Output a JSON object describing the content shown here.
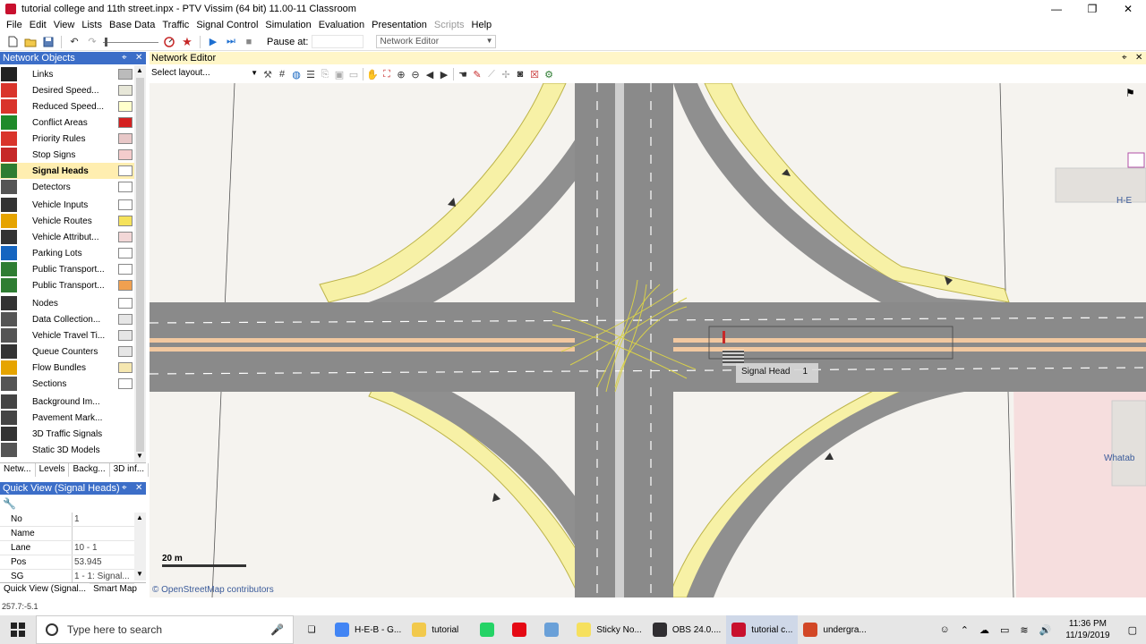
{
  "window": {
    "title": "tutorial college and 11th street.inpx - PTV Vissim (64 bit) 11.00-11 Classroom",
    "controls": [
      "—",
      "❐",
      "✕"
    ]
  },
  "menu": [
    "File",
    "Edit",
    "View",
    "Lists",
    "Base Data",
    "Traffic",
    "Signal Control",
    "Simulation",
    "Evaluation",
    "Presentation",
    "Scripts",
    "Help"
  ],
  "toolbar": {
    "pause_label": "Pause at:",
    "editor_select": "Network Editor"
  },
  "network_objects": {
    "title": "Network Objects",
    "items": [
      {
        "label": "Links",
        "icon": "links-icon",
        "color": "#222222",
        "swatch": "#bbbbbb"
      },
      {
        "label": "Desired Speed...",
        "icon": "desired-speed-icon",
        "color": "#d9342b",
        "swatch": "#e7e7d8"
      },
      {
        "label": "Reduced Speed...",
        "icon": "reduced-speed-icon",
        "color": "#d9342b",
        "swatch": "#ffffcc"
      },
      {
        "label": "Conflict Areas",
        "icon": "conflict-areas-icon",
        "color": "#1f8a2a",
        "swatch": "#d42020"
      },
      {
        "label": "Priority Rules",
        "icon": "priority-rules-icon",
        "color": "#d9342b",
        "swatch": "#e8c8c8"
      },
      {
        "label": "Stop Signs",
        "icon": "stop-signs-icon",
        "color": "#c62828",
        "swatch": "#f4cccc"
      },
      {
        "label": "Signal Heads",
        "icon": "signal-heads-icon",
        "color": "#2e7d32",
        "swatch": "#ffffff"
      },
      {
        "label": "Detectors",
        "icon": "detectors-icon",
        "color": "#555555",
        "swatch": "#ffffff"
      },
      {
        "label": "Vehicle Inputs",
        "icon": "vehicle-inputs-icon",
        "color": "#333333",
        "swatch": "#ffffff"
      },
      {
        "label": "Vehicle Routes",
        "icon": "vehicle-routes-icon",
        "color": "#e6a400",
        "swatch": "#f5e25b"
      },
      {
        "label": "Vehicle Attribut...",
        "icon": "vehicle-attributes-icon",
        "color": "#333333",
        "swatch": "#f2d7d7"
      },
      {
        "label": "Parking Lots",
        "icon": "parking-lots-icon",
        "color": "#1565c0",
        "swatch": "#ffffff"
      },
      {
        "label": "Public Transport...",
        "icon": "public-transport-stops-icon",
        "color": "#2e7d32",
        "swatch": "#ffffff"
      },
      {
        "label": "Public Transport...",
        "icon": "public-transport-lines-icon",
        "color": "#2e7d32",
        "swatch": "#f0a050"
      },
      {
        "label": "Nodes",
        "icon": "nodes-icon",
        "color": "#333333",
        "swatch": "#ffffff"
      },
      {
        "label": "Data Collection...",
        "icon": "data-collection-icon",
        "color": "#555555",
        "swatch": "#e6e6e6"
      },
      {
        "label": "Vehicle Travel Ti...",
        "icon": "vehicle-travel-time-icon",
        "color": "#555555",
        "swatch": "#e6e6e6"
      },
      {
        "label": "Queue Counters",
        "icon": "queue-counters-icon",
        "color": "#333333",
        "swatch": "#e6e6e6"
      },
      {
        "label": "Flow Bundles",
        "icon": "flow-bundles-icon",
        "color": "#e6a400",
        "swatch": "#f5e7b0"
      },
      {
        "label": "Sections",
        "icon": "sections-icon",
        "color": "#555555",
        "swatch": "#ffffff"
      },
      {
        "label": "Background Im...",
        "icon": "background-images-icon",
        "color": "#444444",
        "swatch": ""
      },
      {
        "label": "Pavement Mark...",
        "icon": "pavement-markings-icon",
        "color": "#444444",
        "swatch": ""
      },
      {
        "label": "3D Traffic Signals",
        "icon": "3d-traffic-signals-icon",
        "color": "#333333",
        "swatch": ""
      },
      {
        "label": "Static 3D Models",
        "icon": "static-3d-models-icon",
        "color": "#555555",
        "swatch": ""
      }
    ],
    "selected_index": 6,
    "tabs": [
      "Netw...",
      "Levels",
      "Backg...",
      "3D inf..."
    ]
  },
  "quick_view": {
    "title": "Quick View (Signal Heads)",
    "rows": [
      {
        "key": "No",
        "value": "1"
      },
      {
        "key": "Name",
        "value": ""
      },
      {
        "key": "Lane",
        "value": "10 - 1"
      },
      {
        "key": "Pos",
        "value": "53.945"
      },
      {
        "key": "SG",
        "value": "1 - 1: Signal..."
      }
    ],
    "tabs": [
      "Quick View (Signal...",
      "Smart Map"
    ]
  },
  "network_editor": {
    "title": "Network Editor",
    "layout_select": "Select layout...",
    "scale_label": "20 m",
    "osm_credit": "© OpenStreetMap contributors",
    "signal_head_label": "Signal Head",
    "signal_head_no": "1",
    "poi_label_1": "H-E",
    "poi_label_2": "Whatab"
  },
  "status": {
    "coords": "257.7:-5.1"
  },
  "taskbar": {
    "search_placeholder": "Type here to search",
    "items": [
      {
        "label": "H-E-B - G...",
        "icon": "chrome-icon",
        "color": "#4285f4"
      },
      {
        "label": "tutorial",
        "icon": "folder-icon",
        "color": "#f2c94c"
      },
      {
        "label": "",
        "icon": "whatsapp-icon",
        "color": "#25d366"
      },
      {
        "label": "",
        "icon": "netflix-icon",
        "color": "#e50914"
      },
      {
        "label": "",
        "icon": "notes-app-icon",
        "color": "#6aa0d8"
      },
      {
        "label": "Sticky No...",
        "icon": "sticky-notes-icon",
        "color": "#f6e05e"
      },
      {
        "label": "OBS 24.0....",
        "icon": "obs-icon",
        "color": "#302e31"
      },
      {
        "label": "tutorial c...",
        "icon": "vissim-icon",
        "color": "#c8102e"
      },
      {
        "label": "undergra...",
        "icon": "powerpoint-icon",
        "color": "#d24726"
      }
    ],
    "time": "11:36 PM",
    "date": "11/19/2019"
  }
}
